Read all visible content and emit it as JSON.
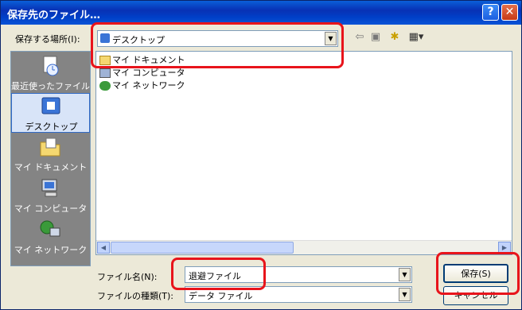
{
  "window": {
    "title": "保存先のファイル…"
  },
  "header": {
    "location_label": "保存する場所(I):",
    "location_value": "デスクトップ"
  },
  "places": [
    {
      "label": "最近使ったファイル",
      "icon": "recent-documents-icon"
    },
    {
      "label": "デスクトップ",
      "icon": "desktop-icon",
      "selected": true
    },
    {
      "label": "マイ ドキュメント",
      "icon": "my-documents-icon"
    },
    {
      "label": "マイ コンピュータ",
      "icon": "my-computer-icon"
    },
    {
      "label": "マイ ネットワーク",
      "icon": "my-network-icon"
    }
  ],
  "files": [
    {
      "name": "マイ ドキュメント",
      "icon": "folder-icon"
    },
    {
      "name": "マイ コンピュータ",
      "icon": "computer-icon"
    },
    {
      "name": "マイ ネットワーク",
      "icon": "network-icon"
    }
  ],
  "form": {
    "filename_label": "ファイル名(N):",
    "filename_value": "退避ファイル",
    "filetype_label": "ファイルの種類(T):",
    "filetype_value": "データ ファイル",
    "save_button": "保存(S)",
    "cancel_button": "キャンセル"
  },
  "colors": {
    "highlight": "#e8141b",
    "titlebar": "#0831b5"
  }
}
